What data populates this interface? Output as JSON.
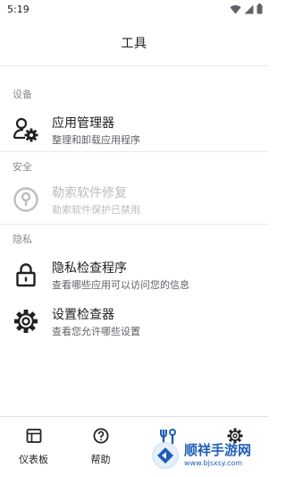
{
  "status_bar": {
    "time": "5:19",
    "icons": [
      "wifi-icon",
      "signal-icon",
      "battery-icon"
    ]
  },
  "app_bar": {
    "title": "工具"
  },
  "sections": [
    {
      "header": "设备",
      "items": [
        {
          "title": "应用管理器",
          "subtitle": "整理和卸载应用程序",
          "icon": "app-manager-icon",
          "enabled": true
        }
      ]
    },
    {
      "header": "安全",
      "items": [
        {
          "title": "勒索软件修复",
          "subtitle": "勒索软件保护已禁用",
          "icon": "lock-circle-icon",
          "enabled": false
        }
      ]
    },
    {
      "header": "隐私",
      "items": [
        {
          "title": "隐私检查程序",
          "subtitle": "查看哪些应用可以访问您的信息",
          "icon": "padlock-icon",
          "enabled": true
        },
        {
          "title": "设置检查器",
          "subtitle": "查看您允许哪些设置",
          "icon": "gear-icon",
          "enabled": true
        }
      ]
    }
  ],
  "bottom_nav": [
    {
      "label": "仪表板",
      "icon": "dashboard-icon"
    },
    {
      "label": "帮助",
      "icon": "help-icon"
    },
    {
      "label": "",
      "icon": "tools-icon"
    },
    {
      "label": "",
      "icon": "settings-icon"
    }
  ],
  "watermark": {
    "name": "顺祥手游网",
    "url": "www.bjsxsy.com"
  },
  "colors": {
    "text": "#202124",
    "muted": "#8a8a8a",
    "disabled": "#bdbdbd",
    "accent": "#1d5fb7"
  }
}
